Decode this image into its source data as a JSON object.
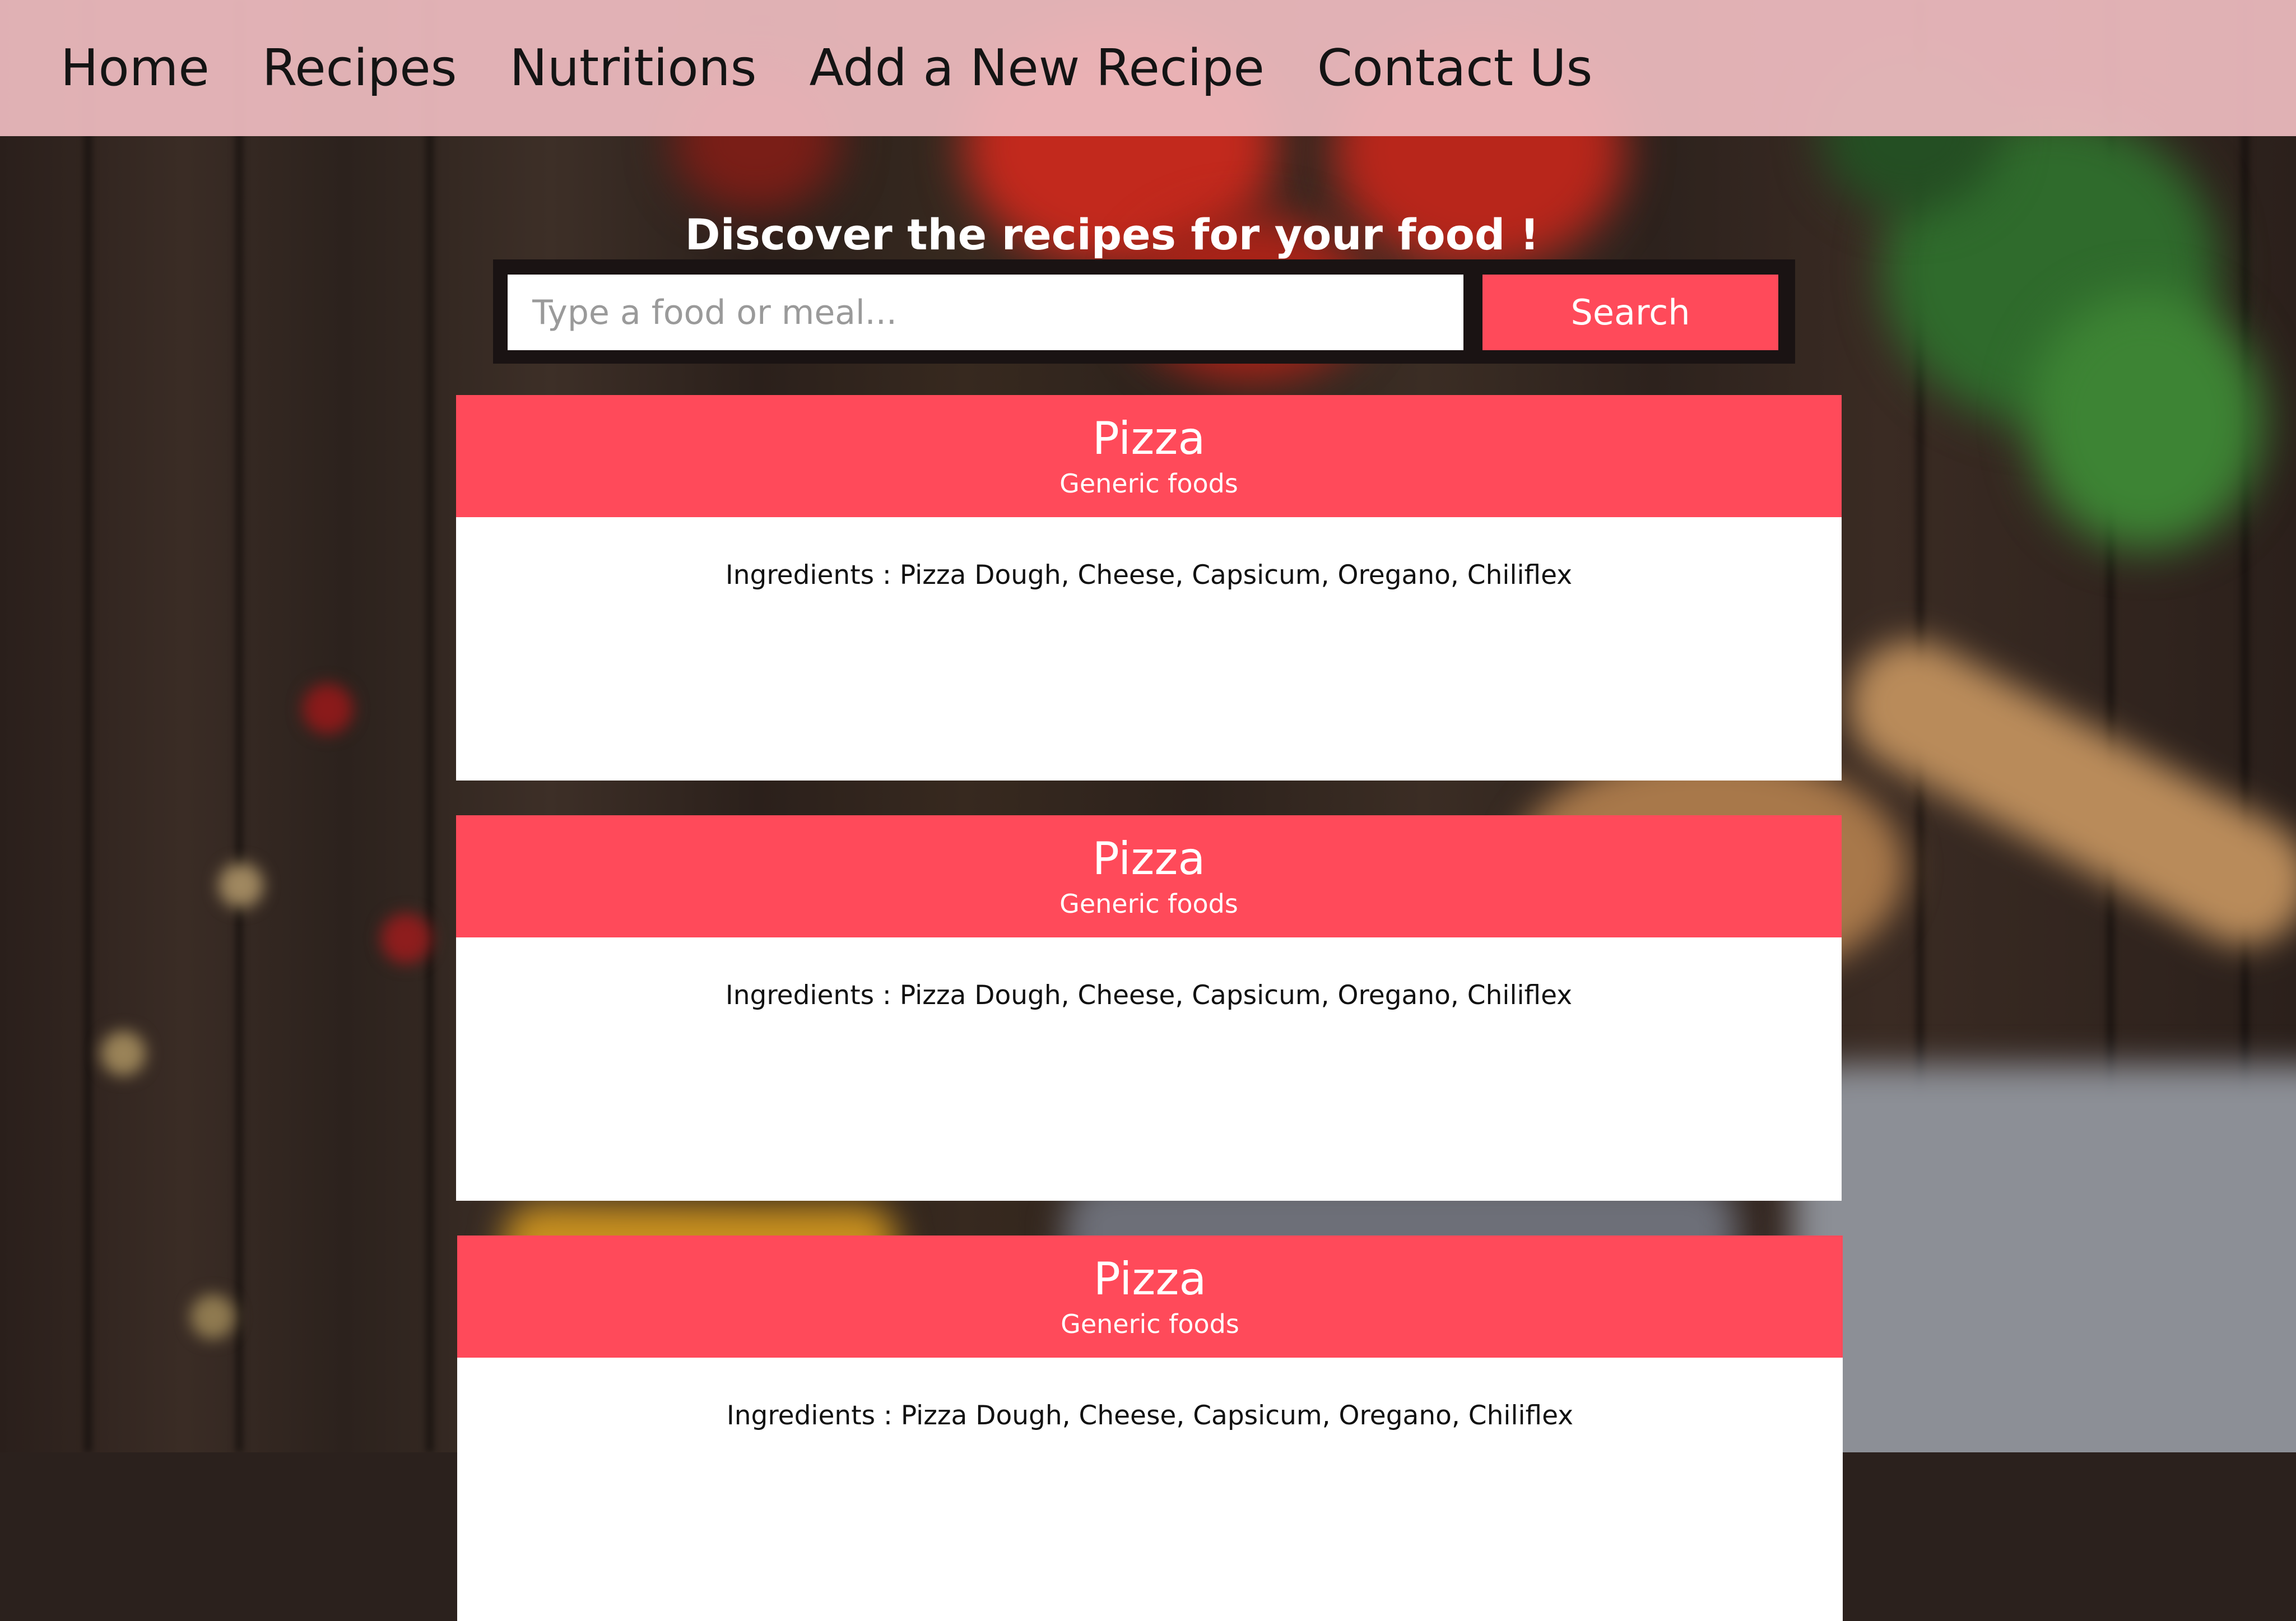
{
  "nav": {
    "items": [
      {
        "label": "Home"
      },
      {
        "label": "Recipes"
      },
      {
        "label": "Nutritions"
      },
      {
        "label": "Add a New Recipe"
      },
      {
        "label": "Contact Us"
      }
    ]
  },
  "hero": {
    "headline": "Discover the recipes for your food !"
  },
  "search": {
    "placeholder": "Type a food or meal...",
    "value": "",
    "button_label": "Search"
  },
  "recipes": [
    {
      "title": "Pizza",
      "category": "Generic foods",
      "ingredients": "Ingredients : Pizza Dough, Cheese, Capsicum, Oregano, Chiliflex"
    },
    {
      "title": "Pizza",
      "category": "Generic foods",
      "ingredients": "Ingredients : Pizza Dough, Cheese, Capsicum, Oregano, Chiliflex"
    },
    {
      "title": "Pizza",
      "category": "Generic foods",
      "ingredients": "Ingredients : Pizza Dough, Cheese, Capsicum, Oregano, Chiliflex"
    }
  ],
  "colors": {
    "accent": "#ff4a5a",
    "navbar": "#ecbabe",
    "search_panel": "#1a1313",
    "card_body": "#ffffff"
  }
}
